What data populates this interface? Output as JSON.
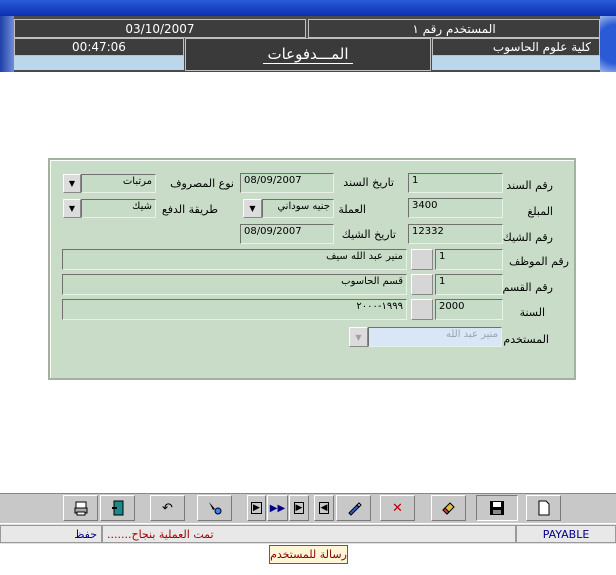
{
  "header": {
    "date": "03/10/2007",
    "user": "المستخدم رقم ١",
    "time": "00:47:06",
    "faculty": "كلية علوم الحاسوب",
    "title": "المـــدفوعات"
  },
  "form": {
    "voucher_no": {
      "label": "رقم السند",
      "value": "1"
    },
    "voucher_date": {
      "label": "تاريخ السند",
      "value": "08/09/2007"
    },
    "expense_type": {
      "label": "نوع المصروف",
      "value": "مرتبات"
    },
    "amount": {
      "label": "المبلغ",
      "value": "3400"
    },
    "currency": {
      "label": "العملة",
      "value": "جنيه سوداني"
    },
    "payment_method": {
      "label": "طريقة الدفع",
      "value": "شيك"
    },
    "cheque_no": {
      "label": "رقم الشيك",
      "value": "12332"
    },
    "cheque_date": {
      "label": "تاريخ الشيك",
      "value": "08/09/2007"
    },
    "employee": {
      "label": "رقم الموظف",
      "id": "1",
      "name": "منير عبد الله سيف"
    },
    "department": {
      "label": "رقم القسم",
      "id": "1",
      "name": "قسم الحاسوب"
    },
    "year": {
      "label": "السنة",
      "id": "2000",
      "name": "١٩٩٩-٢٠٠٠"
    },
    "user": {
      "label": "المستخدم",
      "value": "منير عبد الله"
    }
  },
  "toolbar": {
    "buttons": [
      {
        "name": "print-button",
        "icon": "printer-icon"
      },
      {
        "name": "exit-button",
        "icon": "door-exit-icon"
      },
      {
        "name": "undo-button",
        "icon": "undo-icon"
      },
      {
        "name": "find-button",
        "icon": "find-icon"
      },
      {
        "name": "last-record-button",
        "icon": "last-icon"
      },
      {
        "name": "next-records-button",
        "icon": "fast-forward-icon"
      },
      {
        "name": "next-record-button",
        "icon": "next-icon"
      },
      {
        "name": "previous-record-button",
        "icon": "previous-icon"
      },
      {
        "name": "edit-button",
        "icon": "edit-icon"
      },
      {
        "name": "delete-button",
        "icon": "delete-icon"
      },
      {
        "name": "clear-button",
        "icon": "eraser-icon"
      },
      {
        "name": "save-button",
        "icon": "save-icon"
      },
      {
        "name": "new-button",
        "icon": "new-document-icon"
      }
    ]
  },
  "status": {
    "form_name": "PAYABLE",
    "message": "تمت العملية بنجاح.......",
    "action": "حفظ",
    "tooltip": "رسالة للمستخدم",
    "message_color": "#a00000"
  }
}
